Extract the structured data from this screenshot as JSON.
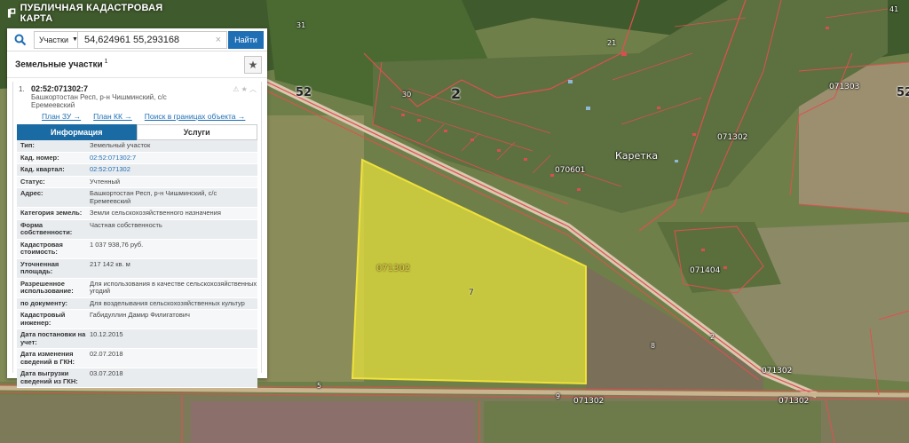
{
  "header": {
    "title": "ПУБЛИЧНАЯ КАДАСТРОВАЯ КАРТА"
  },
  "search": {
    "scope": "Участки",
    "query": "54,624961 55,293168",
    "button": "Найти"
  },
  "results": {
    "title": "Земельные участки",
    "count": "1",
    "item": {
      "index": "1.",
      "cad_number": "02:52:071302:7",
      "address": "Башкортостан Респ, р-н Чишминский, с/с Еремеевский",
      "links": [
        "План ЗУ →",
        "План КК →",
        "Поиск в границах объекта →"
      ]
    }
  },
  "tabs": {
    "info": "Информация",
    "services": "Услуги"
  },
  "attributes": [
    {
      "k": "Тип:",
      "v": "Земельный участок"
    },
    {
      "k": "Кад. номер:",
      "v": "02:52:071302:7",
      "link": true
    },
    {
      "k": "Кад. квартал:",
      "v": "02:52:071302",
      "link": true
    },
    {
      "k": "Статус:",
      "v": "Учтенный"
    },
    {
      "k": "Адрес:",
      "v": "Башкортостан Респ, р-н Чишминский, с/с Еремеевский"
    },
    {
      "k": "Категория земель:",
      "v": "Земли сельскохозяйственного назначения"
    },
    {
      "k": "Форма собственности:",
      "v": "Частная собственность"
    },
    {
      "k": "Кадастровая стоимость:",
      "v": "1 037 938,76 руб."
    },
    {
      "k": "Уточненная площадь:",
      "v": "217 142 кв. м"
    },
    {
      "k": "Разрешенное использование:",
      "v": "Для использования в качестве сельскохозяйственных угодий"
    },
    {
      "k": "по документу:",
      "v": "Для возделывания сельскохозяйственных культур"
    },
    {
      "k": "Кадастровый инженер:",
      "v": "Габидуллин Дамир Филигатович"
    },
    {
      "k": "Дата постановки на учет:",
      "v": "10.12.2015"
    },
    {
      "k": "Дата изменения сведений в ГКН:",
      "v": "02.07.2018"
    },
    {
      "k": "Дата выгрузки сведений из ГКН:",
      "v": "03.07.2018"
    }
  ],
  "map": {
    "road_numbers": [
      "52",
      "52",
      "2"
    ],
    "quarters": [
      "071302",
      "071302",
      "071302",
      "071302",
      "071303",
      "071404",
      "070601",
      "071302"
    ],
    "village": "Каретка",
    "parcel_numbers": [
      "7",
      "8",
      "9",
      "5",
      "31",
      "41",
      "21",
      "30",
      "2"
    ]
  },
  "colors": {
    "accent": "#1f6fb5",
    "parcel_fill": "#e8e33a",
    "boundary": "#e05050"
  }
}
